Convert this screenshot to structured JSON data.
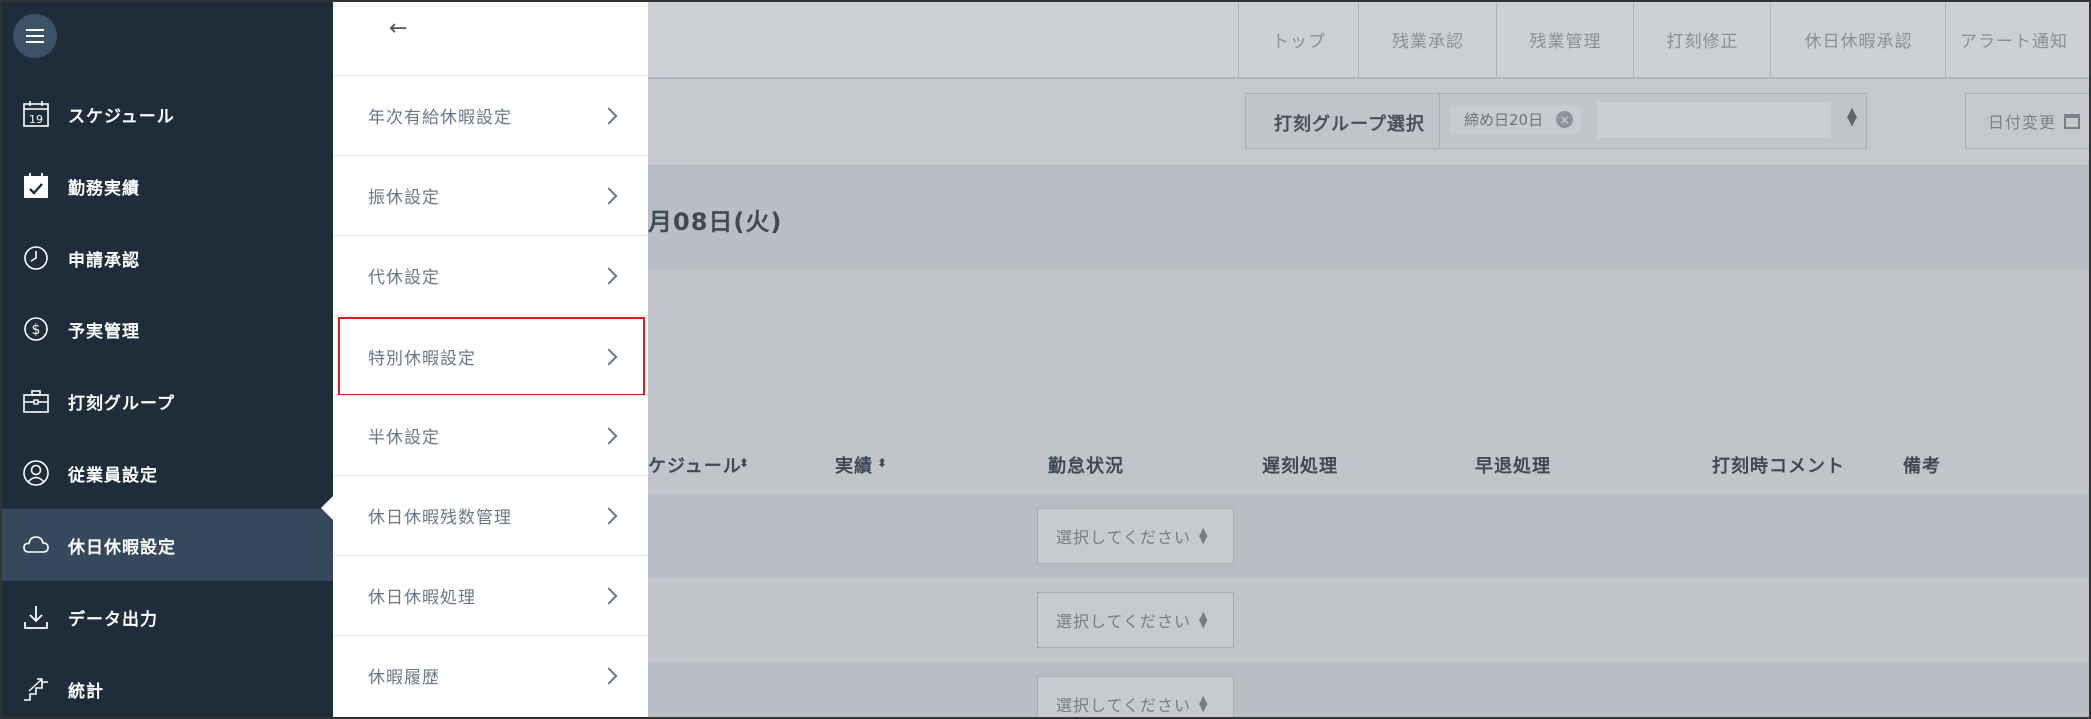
{
  "sidebar": {
    "items": [
      {
        "label": "スケジュール",
        "icon": "calendar-19-icon"
      },
      {
        "label": "勤務実績",
        "icon": "calendar-check-icon"
      },
      {
        "label": "申請承認",
        "icon": "clock-icon"
      },
      {
        "label": "予実管理",
        "icon": "dollar-icon"
      },
      {
        "label": "打刻グループ",
        "icon": "briefcase-icon"
      },
      {
        "label": "従業員設定",
        "icon": "user-icon"
      },
      {
        "label": "休日休暇設定",
        "icon": "cloud-icon",
        "active": true
      },
      {
        "label": "データ出力",
        "icon": "download-icon"
      },
      {
        "label": "統計",
        "icon": "stairs-chart-icon"
      }
    ],
    "calendar_icon_day": "19"
  },
  "submenu": {
    "back_icon": "←",
    "items": [
      {
        "label": "年次有給休暇設定"
      },
      {
        "label": "振休設定"
      },
      {
        "label": "代休設定"
      },
      {
        "label": "特別休暇設定",
        "highlighted": true
      },
      {
        "label": "半休設定"
      },
      {
        "label": "休日休暇残数管理"
      },
      {
        "label": "休日休暇処理"
      },
      {
        "label": "休暇履歴"
      }
    ]
  },
  "topnav": {
    "tabs": [
      "トップ",
      "残業承認",
      "残業管理",
      "打刻修正",
      "休日休暇承認",
      "アラート通知"
    ]
  },
  "toolbar": {
    "group_label": "打刻グループ選択",
    "chip_label": "締め日20日",
    "chip_remove": "×",
    "date_change_label": "日付変更"
  },
  "content": {
    "date_text": "月08日(火)",
    "columns": {
      "schedule": "ケジュール",
      "actual": "実績",
      "status": "勤怠状況",
      "late": "遅刻処理",
      "early": "早退処理",
      "comment": "打刻時コメント",
      "note": "備考"
    },
    "rows": [
      {
        "status_select": "選択してください"
      },
      {
        "status_select": "選択してください"
      },
      {
        "status_select": "選択してください"
      }
    ]
  },
  "colors": {
    "sidebar_bg": "#1f2d3a",
    "sidebar_active": "#36495c",
    "highlight_border": "#e01b1b",
    "overlay_bg": "#c1c5ca"
  }
}
